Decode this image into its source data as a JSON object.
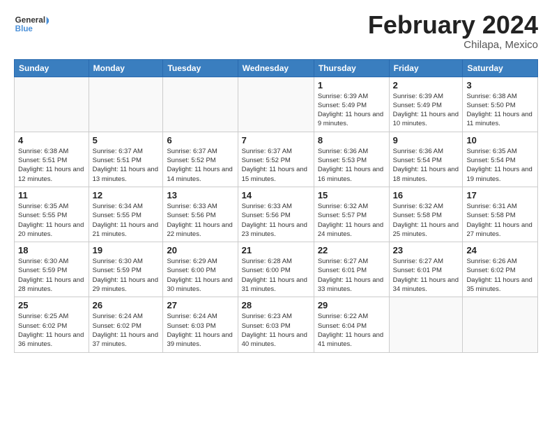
{
  "header": {
    "logo_line1": "General",
    "logo_line2": "Blue",
    "title": "February 2024",
    "subtitle": "Chilapa, Mexico"
  },
  "weekdays": [
    "Sunday",
    "Monday",
    "Tuesday",
    "Wednesday",
    "Thursday",
    "Friday",
    "Saturday"
  ],
  "weeks": [
    [
      {
        "day": "",
        "info": ""
      },
      {
        "day": "",
        "info": ""
      },
      {
        "day": "",
        "info": ""
      },
      {
        "day": "",
        "info": ""
      },
      {
        "day": "1",
        "info": "Sunrise: 6:39 AM\nSunset: 5:49 PM\nDaylight: 11 hours and 9 minutes."
      },
      {
        "day": "2",
        "info": "Sunrise: 6:39 AM\nSunset: 5:49 PM\nDaylight: 11 hours and 10 minutes."
      },
      {
        "day": "3",
        "info": "Sunrise: 6:38 AM\nSunset: 5:50 PM\nDaylight: 11 hours and 11 minutes."
      }
    ],
    [
      {
        "day": "4",
        "info": "Sunrise: 6:38 AM\nSunset: 5:51 PM\nDaylight: 11 hours and 12 minutes."
      },
      {
        "day": "5",
        "info": "Sunrise: 6:37 AM\nSunset: 5:51 PM\nDaylight: 11 hours and 13 minutes."
      },
      {
        "day": "6",
        "info": "Sunrise: 6:37 AM\nSunset: 5:52 PM\nDaylight: 11 hours and 14 minutes."
      },
      {
        "day": "7",
        "info": "Sunrise: 6:37 AM\nSunset: 5:52 PM\nDaylight: 11 hours and 15 minutes."
      },
      {
        "day": "8",
        "info": "Sunrise: 6:36 AM\nSunset: 5:53 PM\nDaylight: 11 hours and 16 minutes."
      },
      {
        "day": "9",
        "info": "Sunrise: 6:36 AM\nSunset: 5:54 PM\nDaylight: 11 hours and 18 minutes."
      },
      {
        "day": "10",
        "info": "Sunrise: 6:35 AM\nSunset: 5:54 PM\nDaylight: 11 hours and 19 minutes."
      }
    ],
    [
      {
        "day": "11",
        "info": "Sunrise: 6:35 AM\nSunset: 5:55 PM\nDaylight: 11 hours and 20 minutes."
      },
      {
        "day": "12",
        "info": "Sunrise: 6:34 AM\nSunset: 5:55 PM\nDaylight: 11 hours and 21 minutes."
      },
      {
        "day": "13",
        "info": "Sunrise: 6:33 AM\nSunset: 5:56 PM\nDaylight: 11 hours and 22 minutes."
      },
      {
        "day": "14",
        "info": "Sunrise: 6:33 AM\nSunset: 5:56 PM\nDaylight: 11 hours and 23 minutes."
      },
      {
        "day": "15",
        "info": "Sunrise: 6:32 AM\nSunset: 5:57 PM\nDaylight: 11 hours and 24 minutes."
      },
      {
        "day": "16",
        "info": "Sunrise: 6:32 AM\nSunset: 5:58 PM\nDaylight: 11 hours and 25 minutes."
      },
      {
        "day": "17",
        "info": "Sunrise: 6:31 AM\nSunset: 5:58 PM\nDaylight: 11 hours and 27 minutes."
      }
    ],
    [
      {
        "day": "18",
        "info": "Sunrise: 6:30 AM\nSunset: 5:59 PM\nDaylight: 11 hours and 28 minutes."
      },
      {
        "day": "19",
        "info": "Sunrise: 6:30 AM\nSunset: 5:59 PM\nDaylight: 11 hours and 29 minutes."
      },
      {
        "day": "20",
        "info": "Sunrise: 6:29 AM\nSunset: 6:00 PM\nDaylight: 11 hours and 30 minutes."
      },
      {
        "day": "21",
        "info": "Sunrise: 6:28 AM\nSunset: 6:00 PM\nDaylight: 11 hours and 31 minutes."
      },
      {
        "day": "22",
        "info": "Sunrise: 6:27 AM\nSunset: 6:01 PM\nDaylight: 11 hours and 33 minutes."
      },
      {
        "day": "23",
        "info": "Sunrise: 6:27 AM\nSunset: 6:01 PM\nDaylight: 11 hours and 34 minutes."
      },
      {
        "day": "24",
        "info": "Sunrise: 6:26 AM\nSunset: 6:02 PM\nDaylight: 11 hours and 35 minutes."
      }
    ],
    [
      {
        "day": "25",
        "info": "Sunrise: 6:25 AM\nSunset: 6:02 PM\nDaylight: 11 hours and 36 minutes."
      },
      {
        "day": "26",
        "info": "Sunrise: 6:24 AM\nSunset: 6:02 PM\nDaylight: 11 hours and 37 minutes."
      },
      {
        "day": "27",
        "info": "Sunrise: 6:24 AM\nSunset: 6:03 PM\nDaylight: 11 hours and 39 minutes."
      },
      {
        "day": "28",
        "info": "Sunrise: 6:23 AM\nSunset: 6:03 PM\nDaylight: 11 hours and 40 minutes."
      },
      {
        "day": "29",
        "info": "Sunrise: 6:22 AM\nSunset: 6:04 PM\nDaylight: 11 hours and 41 minutes."
      },
      {
        "day": "",
        "info": ""
      },
      {
        "day": "",
        "info": ""
      }
    ]
  ]
}
